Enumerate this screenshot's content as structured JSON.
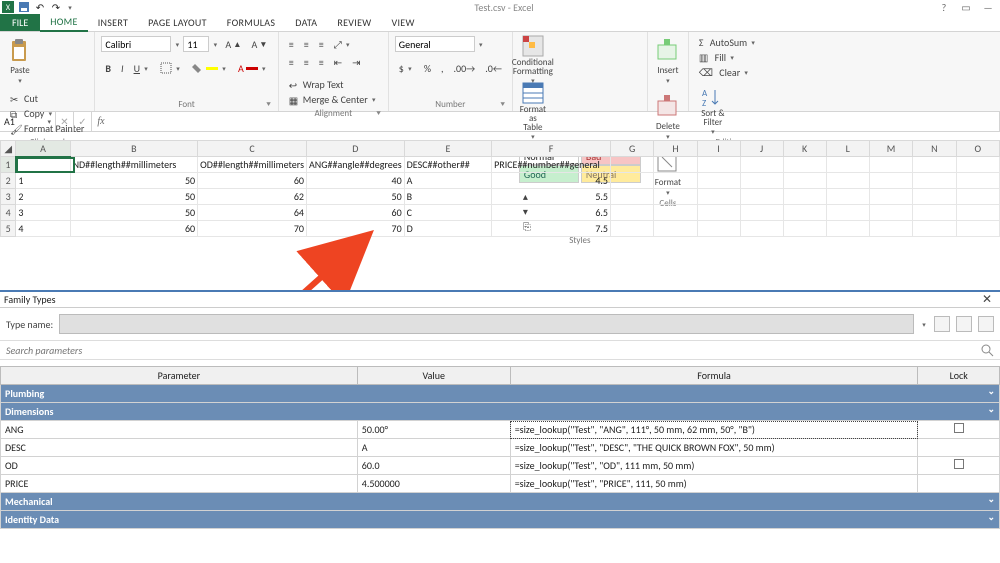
{
  "app": {
    "title": "Test.csv - Excel"
  },
  "qat": {
    "save": "💾",
    "undo": "↶",
    "redo": "↷"
  },
  "tabs": {
    "file": "FILE",
    "items": [
      "HOME",
      "INSERT",
      "PAGE LAYOUT",
      "FORMULAS",
      "DATA",
      "REVIEW",
      "VIEW"
    ],
    "active": 0
  },
  "ribbon": {
    "clipboard": {
      "label": "Clipboard",
      "paste": "Paste",
      "cut": "Cut",
      "copy": "Copy",
      "formatpainter": "Format Painter"
    },
    "font": {
      "label": "Font",
      "name": "Calibri",
      "size": "11"
    },
    "alignment": {
      "label": "Alignment",
      "wrap": "Wrap Text",
      "merge": "Merge & Center"
    },
    "number": {
      "label": "Number",
      "format": "General"
    },
    "styles": {
      "label": "Styles",
      "cond": "Conditional Formatting",
      "fat": "Format as Table",
      "normal": "Normal",
      "bad": "Bad",
      "good": "Good",
      "neutral": "Neutral"
    },
    "cells": {
      "label": "Cells",
      "insert": "Insert",
      "delete": "Delete",
      "format": "Format"
    },
    "editing": {
      "label": "Editing",
      "autosum": "AutoSum",
      "fill": "Fill",
      "clear": "Clear",
      "sortfilter": "Sort & Filter"
    }
  },
  "namebox": "A1",
  "sheet": {
    "cols": [
      "A",
      "B",
      "C",
      "D",
      "E",
      "F",
      "G",
      "H",
      "I",
      "J",
      "K",
      "L",
      "M",
      "N",
      "O"
    ],
    "headers": {
      "B": "ND##length##millimeters",
      "C": "OD##length##millimeters",
      "D": "ANG##angle##degrees",
      "E": "DESC##other##",
      "F": "PRICE##number##general"
    },
    "rows": [
      {
        "A": "1",
        "B": "50",
        "C": "60",
        "D": "40",
        "E": "A",
        "F": "4.5"
      },
      {
        "A": "2",
        "B": "50",
        "C": "62",
        "D": "50",
        "E": "B",
        "F": "5.5"
      },
      {
        "A": "3",
        "B": "50",
        "C": "64",
        "D": "60",
        "E": "C",
        "F": "6.5"
      },
      {
        "A": "4",
        "B": "60",
        "C": "70",
        "D": "70",
        "E": "D",
        "F": "7.5"
      }
    ]
  },
  "dialog": {
    "title": "Family Types",
    "typename_label": "Type name:",
    "search_placeholder": "Search parameters",
    "headers": {
      "parameter": "Parameter",
      "value": "Value",
      "formula": "Formula",
      "lock": "Lock"
    },
    "categories": {
      "plumbing": "Plumbing",
      "dimensions": "Dimensions",
      "mechanical": "Mechanical",
      "identity": "Identity Data"
    },
    "rows": [
      {
        "param": "ANG",
        "value": "50.00°",
        "formula": "=size_lookup(\"Test\", \"ANG\", 111°, 50 mm, 62 mm, 50°, \"B\")",
        "lock": true
      },
      {
        "param": "DESC",
        "value": "A",
        "formula": "=size_lookup(\"Test\", \"DESC\", \"THE QUICK BROWN FOX\", 50 mm)",
        "lock": false
      },
      {
        "param": "OD",
        "value": "60.0",
        "formula": "=size_lookup(\"Test\", \"OD\", 111 mm, 50 mm)",
        "lock": true
      },
      {
        "param": "PRICE",
        "value": "4.500000",
        "formula": "=size_lookup(\"Test\", \"PRICE\", 111, 50 mm)",
        "lock": false
      }
    ]
  }
}
